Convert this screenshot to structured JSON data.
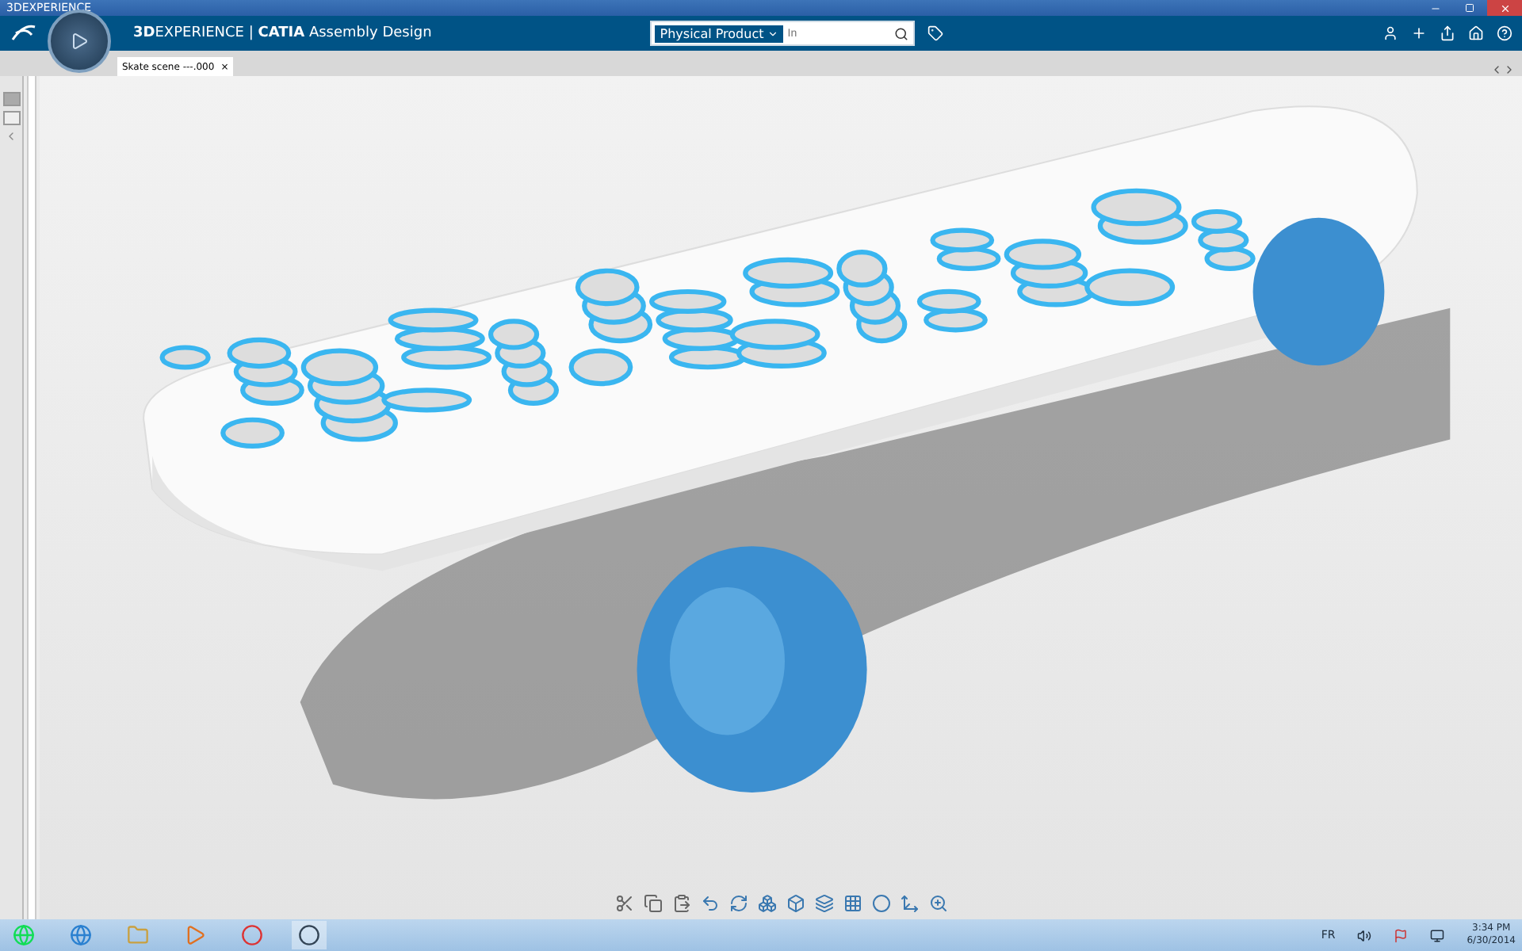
{
  "window": {
    "title": "3DEXPERIENCE"
  },
  "app_bar": {
    "title": "**3D**EXPERIENCE | **CATIA** Assembly Design",
    "search": {
      "scope": "Physical Product",
      "placeholder": "In"
    }
  },
  "tabs": [
    {
      "label": "Skate scene ---.000",
      "selected": true,
      "close": "×"
    }
  ],
  "taskbar": {
    "language": "FR",
    "time": "3:34 PM",
    "date": "6/30/2014"
  }
}
